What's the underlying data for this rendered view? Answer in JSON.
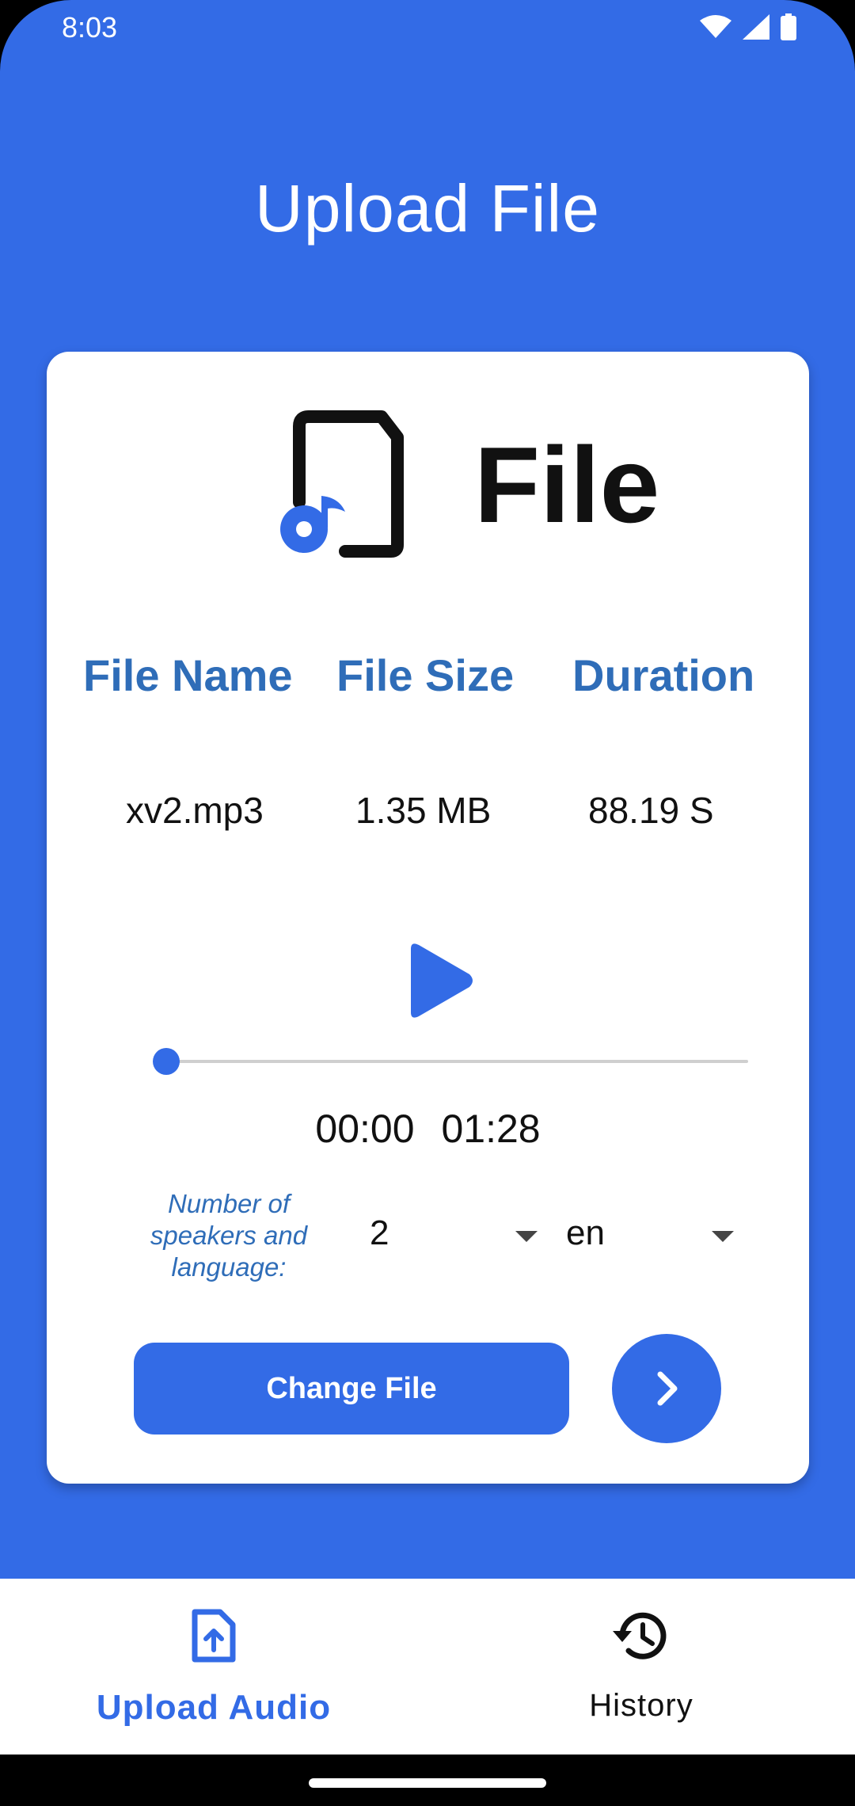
{
  "status_bar": {
    "time": "8:03",
    "icons": [
      "wifi-icon",
      "signal-icon",
      "battery-icon"
    ]
  },
  "header": {
    "title": "Upload File"
  },
  "card": {
    "logo_text": "File",
    "logo_icon": "audio-file-icon",
    "headers": {
      "name": "File Name",
      "size": "File Size",
      "duration": "Duration"
    },
    "values": {
      "name": "xv2.mp3",
      "size": "1.35 MB",
      "duration": "88.19 S"
    },
    "player": {
      "play_icon": "play-icon",
      "current_time": "00:00",
      "total_time": "01:28",
      "progress": 0
    },
    "speakers_label": "Number of speakers and language:",
    "speakers_value": "2",
    "language_value": "en",
    "change_button": "Change File",
    "next_icon": "chevron-right-icon"
  },
  "bottom_nav": {
    "items": [
      {
        "label": "Upload Audio",
        "icon": "upload-file-icon",
        "active": true
      },
      {
        "label": "History",
        "icon": "history-icon",
        "active": false
      }
    ]
  },
  "colors": {
    "primary": "#336BE6",
    "heading": "#2F6DB8",
    "text": "#111111"
  }
}
